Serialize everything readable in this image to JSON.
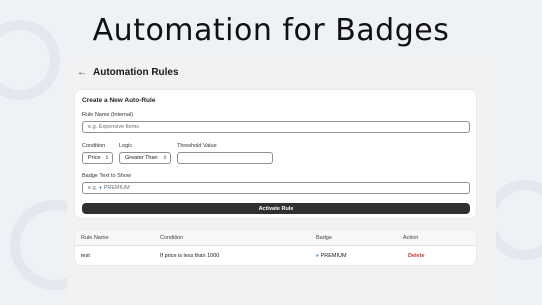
{
  "hero": {
    "title": "Automation for Badges"
  },
  "panel": {
    "back_icon": "arrow-left-icon",
    "title": "Automation Rules"
  },
  "form": {
    "section_title": "Create a New Auto-Rule",
    "rule_name": {
      "label": "Rule Name (Internal)",
      "placeholder": "e.g. Expensive Items",
      "value": ""
    },
    "condition": {
      "label": "Condition",
      "value": "Price"
    },
    "logic": {
      "label": "Logic",
      "value": "Greater Than"
    },
    "threshold": {
      "label": "Threshold Value",
      "value": ""
    },
    "badge_text": {
      "label": "Badge Text to Show",
      "prefix": "e.g.",
      "gem_icon": "diamond-icon",
      "placeholder": "PREMIUM"
    },
    "activate_label": "Activate Rule"
  },
  "table": {
    "headers": [
      "Rule Name",
      "Condition",
      "Badge",
      "Action"
    ],
    "rows": [
      {
        "rule_name": "test",
        "condition": "If price is less than 1000",
        "badge_icon": "diamond-icon",
        "badge": "PREMIUM",
        "action": "Delete"
      }
    ]
  },
  "colors": {
    "accent_dark": "#303030",
    "delete": "#c0392b",
    "gem": "#3a84d8"
  }
}
